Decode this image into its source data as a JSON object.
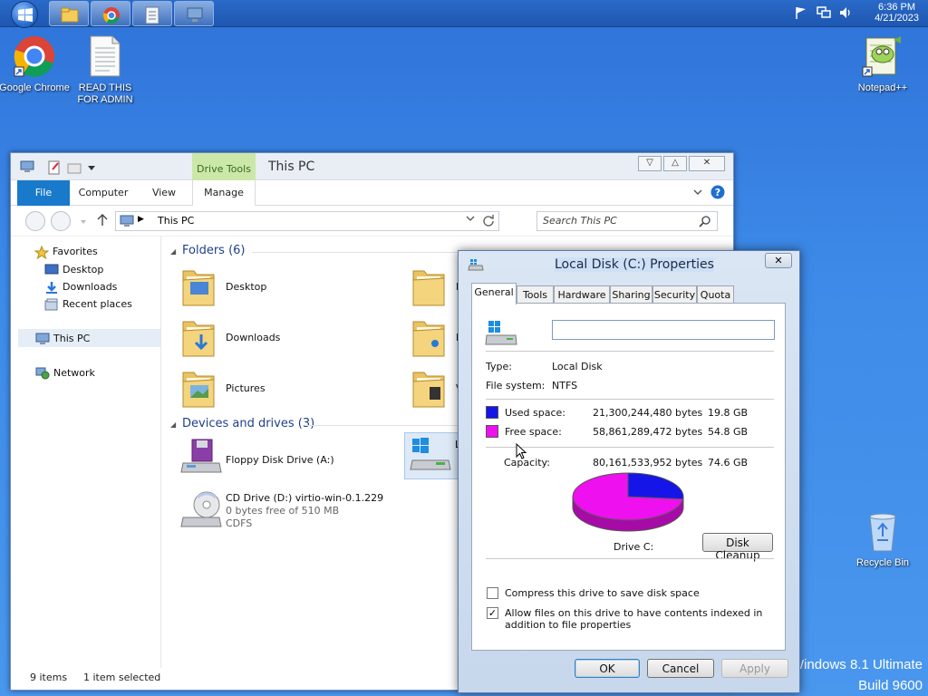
{
  "taskbar": {
    "clock": {
      "time": "6:36 PM",
      "date": "4/21/2023"
    },
    "icons": [
      "windows-start-icon",
      "file-explorer-icon",
      "chrome-icon",
      "notepad-icon",
      "this-pc-icon"
    ]
  },
  "desktop": {
    "icons": [
      {
        "label": "Google Chrome"
      },
      {
        "label": "READ THIS FOR ADMIN"
      },
      {
        "label": "Notepad++"
      },
      {
        "label": "Recycle Bin"
      }
    ],
    "watermark": {
      "line1": "Windows 8.1 Ultimate",
      "line2": "Build 9600"
    }
  },
  "explorer": {
    "title": "This PC",
    "drive_tools": "Drive Tools",
    "ribbon_tabs": [
      "File",
      "Computer",
      "View",
      "Manage"
    ],
    "address": "This PC",
    "search_placeholder": "Search This PC",
    "nav": {
      "favorites": "Favorites",
      "desktop": "Desktop",
      "downloads": "Downloads",
      "recent": "Recent places",
      "this_pc": "This PC",
      "network": "Network"
    },
    "folders_header": "Folders (6)",
    "folders": [
      "Desktop",
      "Downloads",
      "Pictures"
    ],
    "folders_right_letters": [
      "D",
      "M",
      "V"
    ],
    "devices_header": "Devices and drives (3)",
    "floppy": "Floppy Disk Drive (A:)",
    "cd": {
      "name": "CD Drive (D:) virtio-win-0.1.229",
      "free": "0 bytes free of 510 MB",
      "fs": "CDFS"
    },
    "local_letter": "L",
    "status": {
      "items": "9 items",
      "selected": "1 item selected"
    }
  },
  "properties": {
    "title": "Local Disk (C:) Properties",
    "close": "✕",
    "tabs": [
      "General",
      "Tools",
      "Hardware",
      "Sharing",
      "Security",
      "Quota"
    ],
    "name_value": "",
    "type_label": "Type:",
    "type_value": "Local Disk",
    "fs_label": "File system:",
    "fs_value": "NTFS",
    "used_label": "Used space:",
    "used_bytes": "21,300,244,480 bytes",
    "used_gb": "19.8 GB",
    "free_label": "Free space:",
    "free_bytes": "58,861,289,472 bytes",
    "free_gb": "54.8 GB",
    "capacity_label": "Capacity:",
    "capacity_bytes": "80,161,533,952 bytes",
    "capacity_gb": "74.6 GB",
    "drive_label": "Drive C:",
    "disk_cleanup": "Disk Cleanup",
    "compress": "Compress this drive to save disk space",
    "index": "Allow files on this drive to have contents indexed in addition to file properties",
    "compress_checked": false,
    "index_checked": true,
    "ok": "OK",
    "cancel": "Cancel",
    "apply": "Apply",
    "colors": {
      "used": "#1515e8",
      "free": "#ee10ee"
    },
    "used_fraction": 0.266
  }
}
